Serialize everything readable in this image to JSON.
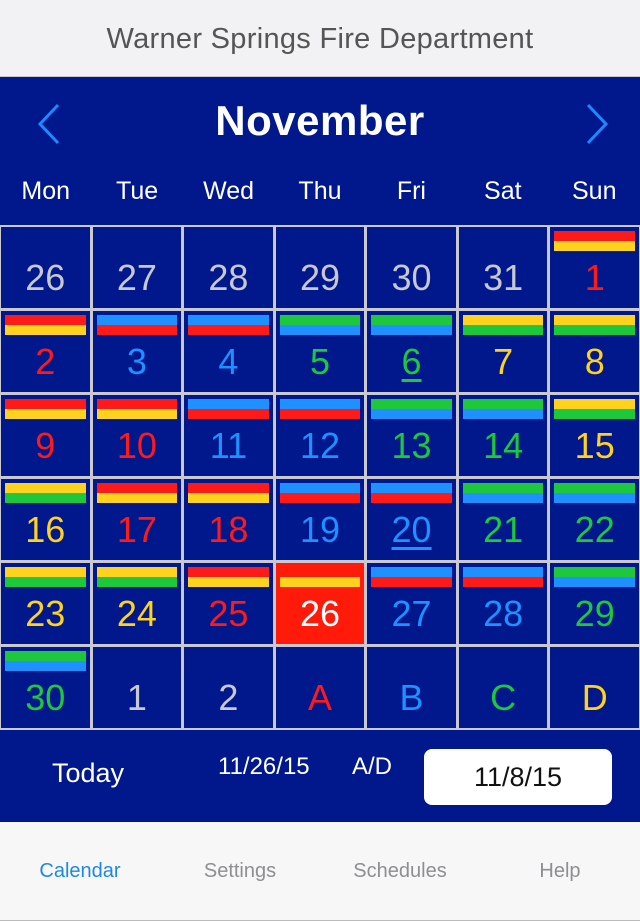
{
  "header": {
    "title": "Warner Springs Fire Department"
  },
  "calendar": {
    "month": "November",
    "prev_icon": "chevron-left-icon",
    "next_icon": "chevron-right-icon",
    "weekdays": [
      "Mon",
      "Tue",
      "Wed",
      "Thu",
      "Fri",
      "Sat",
      "Sun"
    ],
    "colors": {
      "A": "#ff1a1a",
      "B": "#1e90ff",
      "C": "#1ec83c",
      "D": "#ffd21e",
      "muted": "#c8c8d0",
      "today_bg": "#ff1a0a",
      "today_text": "#ffffff",
      "navy": "#00188c"
    },
    "days": [
      {
        "label": "26",
        "shift": "muted",
        "bars": []
      },
      {
        "label": "27",
        "shift": "muted",
        "bars": []
      },
      {
        "label": "28",
        "shift": "muted",
        "bars": []
      },
      {
        "label": "29",
        "shift": "muted",
        "bars": []
      },
      {
        "label": "30",
        "shift": "muted",
        "bars": []
      },
      {
        "label": "31",
        "shift": "muted",
        "bars": []
      },
      {
        "label": "1",
        "shift": "A",
        "bars": [
          "A",
          "D"
        ]
      },
      {
        "label": "2",
        "shift": "A",
        "bars": [
          "A",
          "D"
        ]
      },
      {
        "label": "3",
        "shift": "B",
        "bars": [
          "B",
          "A"
        ]
      },
      {
        "label": "4",
        "shift": "B",
        "bars": [
          "B",
          "A"
        ]
      },
      {
        "label": "5",
        "shift": "C",
        "bars": [
          "C",
          "B"
        ]
      },
      {
        "label": "6",
        "shift": "C",
        "bars": [
          "C",
          "B"
        ],
        "underline": true
      },
      {
        "label": "7",
        "shift": "D",
        "bars": [
          "D",
          "C"
        ]
      },
      {
        "label": "8",
        "shift": "D",
        "bars": [
          "D",
          "C"
        ]
      },
      {
        "label": "9",
        "shift": "A",
        "bars": [
          "A",
          "D"
        ]
      },
      {
        "label": "10",
        "shift": "A",
        "bars": [
          "A",
          "D"
        ]
      },
      {
        "label": "11",
        "shift": "B",
        "bars": [
          "B",
          "A"
        ]
      },
      {
        "label": "12",
        "shift": "B",
        "bars": [
          "B",
          "A"
        ]
      },
      {
        "label": "13",
        "shift": "C",
        "bars": [
          "C",
          "B"
        ]
      },
      {
        "label": "14",
        "shift": "C",
        "bars": [
          "C",
          "B"
        ]
      },
      {
        "label": "15",
        "shift": "D",
        "bars": [
          "D",
          "C"
        ]
      },
      {
        "label": "16",
        "shift": "D",
        "bars": [
          "D",
          "C"
        ]
      },
      {
        "label": "17",
        "shift": "A",
        "bars": [
          "A",
          "D"
        ]
      },
      {
        "label": "18",
        "shift": "A",
        "bars": [
          "A",
          "D"
        ]
      },
      {
        "label": "19",
        "shift": "B",
        "bars": [
          "B",
          "A"
        ]
      },
      {
        "label": "20",
        "shift": "B",
        "bars": [
          "B",
          "A"
        ],
        "underline": true
      },
      {
        "label": "21",
        "shift": "C",
        "bars": [
          "C",
          "B"
        ]
      },
      {
        "label": "22",
        "shift": "C",
        "bars": [
          "C",
          "B"
        ]
      },
      {
        "label": "23",
        "shift": "D",
        "bars": [
          "D",
          "C"
        ]
      },
      {
        "label": "24",
        "shift": "D",
        "bars": [
          "D",
          "C"
        ]
      },
      {
        "label": "25",
        "shift": "A",
        "bars": [
          "A",
          "D"
        ]
      },
      {
        "label": "26",
        "shift": "today",
        "bars": [
          "A",
          "D"
        ],
        "today": true
      },
      {
        "label": "27",
        "shift": "B",
        "bars": [
          "B",
          "A"
        ]
      },
      {
        "label": "28",
        "shift": "B",
        "bars": [
          "B",
          "A"
        ]
      },
      {
        "label": "29",
        "shift": "C",
        "bars": [
          "C",
          "B"
        ]
      },
      {
        "label": "30",
        "shift": "C",
        "bars": [
          "C",
          "B"
        ]
      },
      {
        "label": "1",
        "shift": "muted",
        "bars": []
      },
      {
        "label": "2",
        "shift": "muted",
        "bars": []
      },
      {
        "label": "A",
        "shift": "A",
        "bars": []
      },
      {
        "label": "B",
        "shift": "B",
        "bars": []
      },
      {
        "label": "C",
        "shift": "C",
        "bars": []
      },
      {
        "label": "D",
        "shift": "D",
        "bars": []
      }
    ]
  },
  "footer": {
    "today_label": "Today",
    "today_date": "11/26/15",
    "ad_label": "A/D",
    "date_field_value": "11/8/15"
  },
  "tabs": [
    {
      "label": "Calendar",
      "active": true
    },
    {
      "label": "Settings",
      "active": false
    },
    {
      "label": "Schedules",
      "active": false
    },
    {
      "label": "Help",
      "active": false
    }
  ]
}
